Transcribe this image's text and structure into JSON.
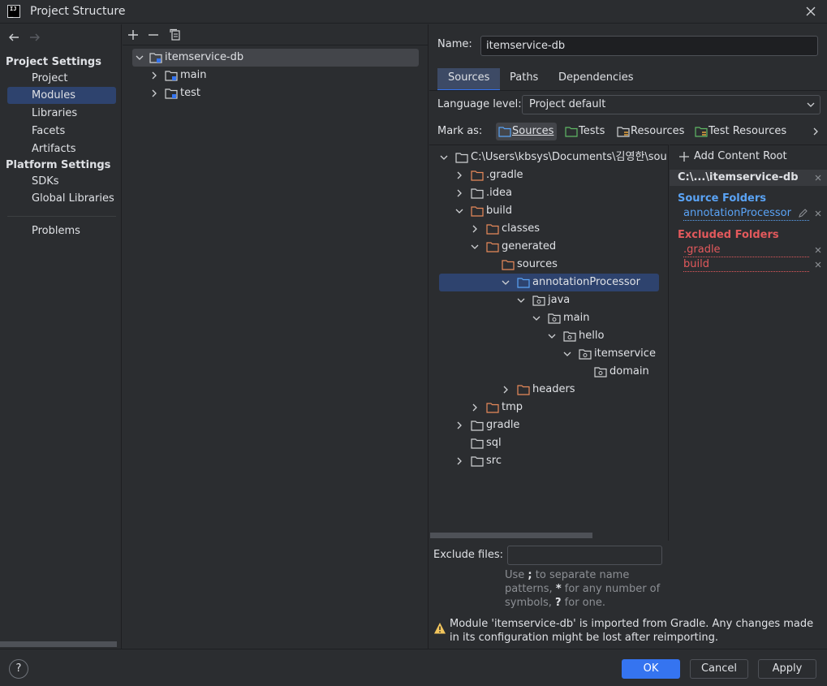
{
  "window": {
    "title": "Project Structure"
  },
  "sidebar": {
    "project_settings_header": "Project Settings",
    "project_items": [
      {
        "label": "Project"
      },
      {
        "label": "Modules",
        "selected": true
      },
      {
        "label": "Libraries"
      },
      {
        "label": "Facets"
      },
      {
        "label": "Artifacts"
      }
    ],
    "platform_settings_header": "Platform Settings",
    "platform_items": [
      {
        "label": "SDKs"
      },
      {
        "label": "Global Libraries"
      }
    ],
    "problems_label": "Problems"
  },
  "module_tree": {
    "root": "itemservice-db",
    "children": [
      "main",
      "test"
    ]
  },
  "details": {
    "name_label": "Name:",
    "name_value": "itemservice-db",
    "tabs": [
      {
        "label": "Sources",
        "active": true
      },
      {
        "label": "Paths"
      },
      {
        "label": "Dependencies"
      }
    ],
    "language_level_label": "Language level:",
    "language_level_value": "Project default",
    "mark_as_label": "Mark as:",
    "mark_as": [
      {
        "label": "Sources",
        "icon": "source-folder-icon",
        "selected": true
      },
      {
        "label": "Tests",
        "icon": "test-folder-icon"
      },
      {
        "label": "Resources",
        "icon": "resources-folder-icon"
      },
      {
        "label": "Test Resources",
        "icon": "test-resources-folder-icon"
      }
    ],
    "content_tree": {
      "root": "C:\\Users\\kbsys\\Documents\\김영한\\sou",
      "nodes": [
        {
          "label": ".gradle"
        },
        {
          "label": ".idea"
        },
        {
          "label": "build"
        },
        {
          "label": "classes"
        },
        {
          "label": "generated"
        },
        {
          "label": "sources"
        },
        {
          "label": "annotationProcessor"
        },
        {
          "label": "java"
        },
        {
          "label": "main"
        },
        {
          "label": "hello"
        },
        {
          "label": "itemservice"
        },
        {
          "label": "domain"
        },
        {
          "label": "headers"
        },
        {
          "label": "tmp"
        },
        {
          "label": "gradle"
        },
        {
          "label": "sql"
        },
        {
          "label": "src"
        }
      ]
    },
    "content_root": {
      "add_label": "Add Content Root",
      "path": "C:\\...\\itemservice-db",
      "source_folders_header": "Source Folders",
      "source_folders": [
        "annotationProcessor"
      ],
      "excluded_folders_header": "Excluded Folders",
      "excluded_folders": [
        ".gradle",
        "build"
      ]
    },
    "exclude_files_label": "Exclude files:",
    "exclude_files_value": "",
    "exclude_help": {
      "part1": "Use ",
      "sep": ";",
      "part2": " to separate name patterns, ",
      "star": "*",
      "part3": " for any number of symbols, ",
      "q": "?",
      "part4": " for one."
    },
    "warning": "Module 'itemservice-db' is imported from Gradle. Any changes made in its configuration might be lost after reimporting."
  },
  "footer": {
    "help_label": "?",
    "ok_label": "OK",
    "cancel_label": "Cancel",
    "apply_label": "Apply"
  },
  "colors": {
    "background": "#2b2d30",
    "selection": "#2e436e",
    "accent": "#3574f0",
    "source_folder": "#5aa3f5",
    "excluded_folder": "#e3595c",
    "folder_orange": "#e88a5a"
  }
}
